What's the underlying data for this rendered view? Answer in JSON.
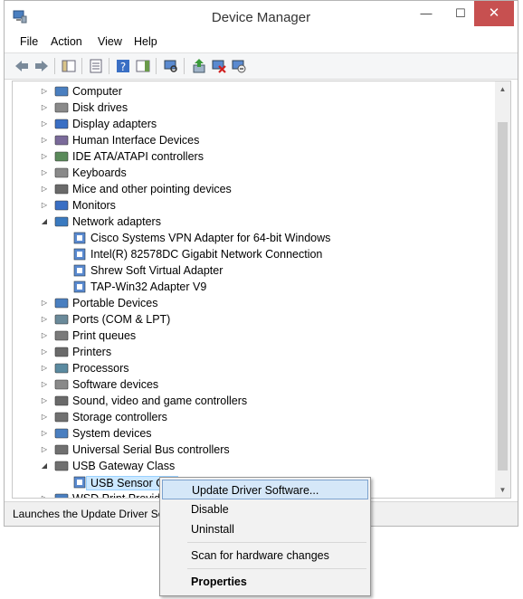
{
  "window": {
    "title": "Device Manager",
    "minimize": "—",
    "maximize": "☐",
    "close": "✕"
  },
  "menu": {
    "file": "File",
    "action": "Action",
    "view": "View",
    "help": "Help"
  },
  "tree": {
    "categories": [
      {
        "label": "Computer",
        "expanded": false
      },
      {
        "label": "Disk drives",
        "expanded": false
      },
      {
        "label": "Display adapters",
        "expanded": false
      },
      {
        "label": "Human Interface Devices",
        "expanded": false
      },
      {
        "label": "IDE ATA/ATAPI controllers",
        "expanded": false
      },
      {
        "label": "Keyboards",
        "expanded": false
      },
      {
        "label": "Mice and other pointing devices",
        "expanded": false
      },
      {
        "label": "Monitors",
        "expanded": false
      },
      {
        "label": "Network adapters",
        "expanded": true,
        "children": [
          "Cisco Systems VPN Adapter for 64-bit Windows",
          "Intel(R) 82578DC Gigabit Network Connection",
          "Shrew Soft Virtual Adapter",
          "TAP-Win32 Adapter V9"
        ]
      },
      {
        "label": "Portable Devices",
        "expanded": false
      },
      {
        "label": "Ports (COM & LPT)",
        "expanded": false
      },
      {
        "label": "Print queues",
        "expanded": false
      },
      {
        "label": "Printers",
        "expanded": false
      },
      {
        "label": "Processors",
        "expanded": false
      },
      {
        "label": "Software devices",
        "expanded": false
      },
      {
        "label": "Sound, video and game controllers",
        "expanded": false
      },
      {
        "label": "Storage controllers",
        "expanded": false
      },
      {
        "label": "System devices",
        "expanded": false
      },
      {
        "label": "Universal Serial Bus controllers",
        "expanded": false
      },
      {
        "label": "USB Gateway Class",
        "expanded": true,
        "children": [
          "USB Sensor Gat"
        ]
      },
      {
        "label": "WSD Print Provider",
        "expanded": false
      }
    ]
  },
  "status": {
    "text": "Launches the Update Driver Sof"
  },
  "context_menu": {
    "update": "Update Driver Software...",
    "disable": "Disable",
    "uninstall": "Uninstall",
    "scan": "Scan for hardware changes",
    "properties": "Properties"
  }
}
